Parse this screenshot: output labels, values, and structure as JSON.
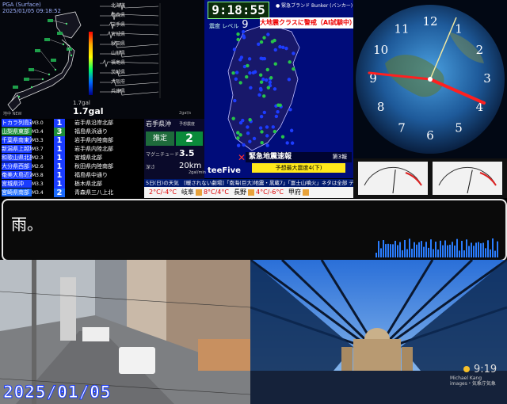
{
  "seismic_map": {
    "header_line1": "PGA (Surface)",
    "header_line2": "2025/01/05  09:18:52",
    "peak_value": "1.7gal",
    "peak_label": "1.7gal",
    "footer_left": "地中 NEW",
    "footer_right": "2gal/s",
    "wave_stations": [
      "北海道",
      "青森県",
      "岩手県",
      "宮城県",
      "秋田県",
      "山形県",
      "福島県",
      "茨城県",
      "大阪府",
      "兵庫県"
    ]
  },
  "earthquake": {
    "digital_time": "9:18:55",
    "level_label": "震度 レベル",
    "level_value": "9",
    "brand": "● 緊急ブランド Bunker (バンカー)",
    "alert": "大地震クラスに警戒（AI試験中）",
    "eew_title": "緊急地震速報",
    "eew_number": "第3報",
    "eew_sub": "予想最大震度4(下)",
    "eew_mark": "✕",
    "watermark": "teeFive"
  },
  "quake_list": [
    {
      "loc": "トカラ列島近海",
      "mag": "M3.0",
      "int": "1",
      "color": "#1a3cff",
      "area": "岩手県沿岸北部"
    },
    {
      "loc": "山梨県東部・富士五湖",
      "mag": "M3.4",
      "int": "3",
      "color": "#1e8f3a",
      "area": "福島県浜通り"
    },
    {
      "loc": "千葉県南東沖",
      "mag": "M3.3",
      "int": "1",
      "color": "#1a3cff",
      "area": "岩手県内陸南部"
    },
    {
      "loc": "新潟県上越地方",
      "mag": "M3.7",
      "int": "1",
      "color": "#1a3cff",
      "area": "岩手県内陸北部"
    },
    {
      "loc": "和歌山県北部",
      "mag": "M2.3",
      "int": "1",
      "color": "#1a3cff",
      "area": "宮城県北部"
    },
    {
      "loc": "大分県西部",
      "mag": "M2.6",
      "int": "1",
      "color": "#1a3cff",
      "area": "秋田県内陸南部"
    },
    {
      "loc": "奄美大島近海",
      "mag": "M3.8",
      "int": "1",
      "color": "#1a3cff",
      "area": "福島県中通り"
    },
    {
      "loc": "宮城県沖",
      "mag": "M3.3",
      "int": "1",
      "color": "#1a3cff",
      "area": "栃木県北部"
    },
    {
      "loc": "宮崎県南部",
      "mag": "M3.4",
      "int": "2",
      "color": "#1a6bff",
      "area": "青森県三八上北"
    }
  ],
  "prefecture": {
    "name": "岩手県沖",
    "sub": "予想震度",
    "estimate": "推定",
    "intensity": "2",
    "mag_label": "マグニチュード",
    "mag_value": "3.5",
    "depth_label": "深さ",
    "depth_value": "20km",
    "gal": "2gal/min"
  },
  "weather": {
    "top": "5日(日)の天気　[暖されない劇場]「南海(巨大)地震・黒蔵7」「富士山噴火」ネタは全部 デマ",
    "cities": [
      {
        "name": "",
        "temp": "2°C/-4°C"
      },
      {
        "name": "岐阜",
        "temp": "8°C/4°C"
      },
      {
        "name": "長野",
        "temp": "4°C/-6°C"
      },
      {
        "name": "甲府",
        "temp": ""
      }
    ]
  },
  "meters": [
    0.55,
    0.6
  ],
  "subtitle": {
    "text": "雨。"
  },
  "street_cam": {
    "date": "2025/01/05"
  },
  "cathedral_cam": {
    "time": "9:19",
    "credit_line1": "Michael Kang",
    "credit_line2": "images・気象庁気象"
  },
  "colors": {
    "eq_bg": "#000c7a",
    "alert_text": "#ee0000",
    "clock_hand_red": "#ff2020",
    "subtitle_border": "#e8e8e8",
    "spectrum": "#2a7dff"
  }
}
